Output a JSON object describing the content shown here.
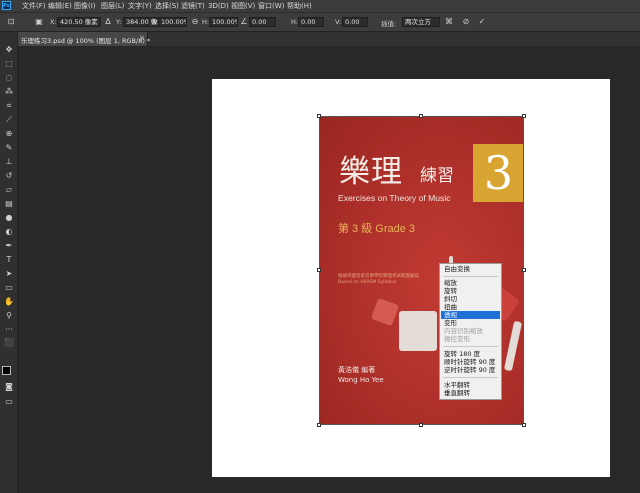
{
  "app": {
    "logo_text": "Ps"
  },
  "menubar": {
    "items": [
      "文件(F)",
      "编辑(E)",
      "图像(I)",
      "图层(L)",
      "文字(Y)",
      "选择(S)",
      "滤镜(T)",
      "3D(D)",
      "视图(V)",
      "窗口(W)",
      "帮助(H)"
    ]
  },
  "options": {
    "x_label": "X:",
    "x_value": "420.50 像素",
    "y_label": "Y:",
    "y_value": "384.00 像素",
    "w_label": "W:",
    "w_value": "100.00%",
    "h_label": "H:",
    "h_value": "100.00%",
    "angle_value": "0.00",
    "hskew_label": "H:",
    "hskew_value": "0.00",
    "vskew_label": "V:",
    "vskew_value": "0.00",
    "interp_label": "插值:",
    "interp_value": "两次立方"
  },
  "document_tab": {
    "label": "乐理练习3.psd @ 100% (图层 1, RGB/8) *",
    "close": "×"
  },
  "book": {
    "title_big": "樂理",
    "title_small": "練習",
    "number": "3",
    "english_title": "Exercises on Theory of Music",
    "grade": "第 3 級   Grade 3",
    "syllabus_zh": "根據英國皇家音樂學院樂理考試範圍編寫",
    "syllabus_en": "Based on ABRSM Syllabus",
    "author_zh": "黃浩儀  編著",
    "author_en": "Wong Ho Yee"
  },
  "context_menu": {
    "items": [
      {
        "label": "自由变换",
        "state": "normal"
      },
      {
        "label": "缩放",
        "state": "normal"
      },
      {
        "label": "旋转",
        "state": "normal"
      },
      {
        "label": "斜切",
        "state": "normal"
      },
      {
        "label": "扭曲",
        "state": "normal"
      },
      {
        "label": "透视",
        "state": "selected"
      },
      {
        "label": "变形",
        "state": "normal"
      },
      {
        "label": "内容识别缩放",
        "state": "disabled"
      },
      {
        "label": "操控变形",
        "state": "disabled"
      },
      {
        "label": "旋转 180 度",
        "state": "normal"
      },
      {
        "label": "顺时针旋转 90 度",
        "state": "normal"
      },
      {
        "label": "逆时针旋转 90 度",
        "state": "normal"
      },
      {
        "label": "水平翻转",
        "state": "normal"
      },
      {
        "label": "垂直翻转",
        "state": "normal"
      }
    ]
  },
  "colors": {
    "accent": "#1f6fd6",
    "book_red": "#b8332f",
    "book_gold": "#d8a533"
  }
}
